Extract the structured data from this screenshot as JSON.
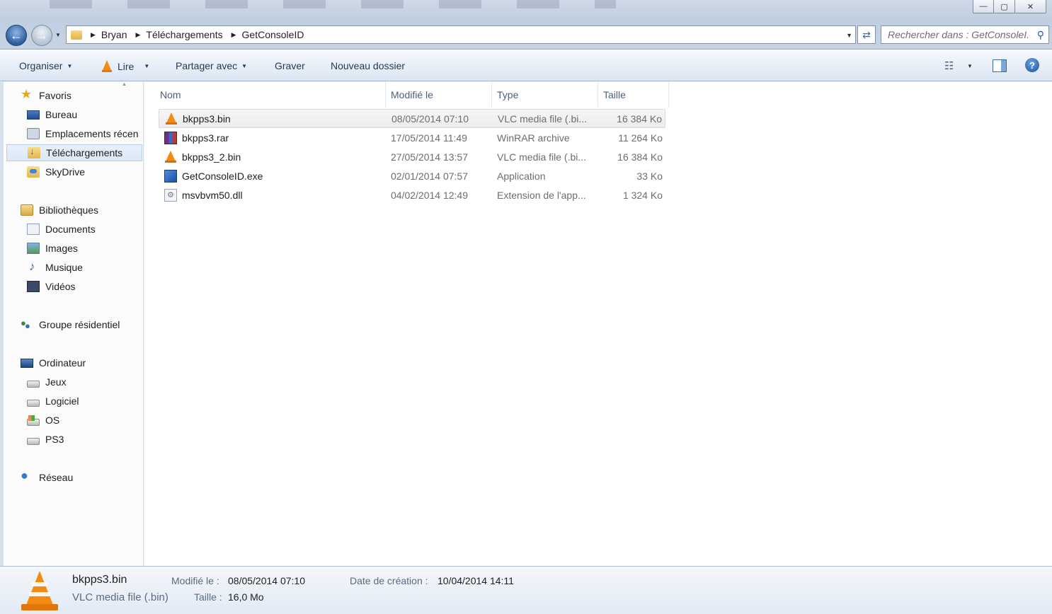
{
  "window": {
    "controls": {
      "minimize": "—",
      "maximize": "▢",
      "close": "✕"
    }
  },
  "address": {
    "crumbs": [
      "Bryan",
      "Téléchargements",
      "GetConsoleID"
    ],
    "search_placeholder": "Rechercher dans : GetConsoleI..."
  },
  "toolbar": {
    "organiser": "Organiser",
    "lire": "Lire",
    "partager": "Partager avec",
    "graver": "Graver",
    "nouveau_dossier": "Nouveau dossier"
  },
  "nav": {
    "favoris": "Favoris",
    "bureau": "Bureau",
    "emplacements": "Emplacements récen",
    "telechargements": "Téléchargements",
    "skydrive": "SkyDrive",
    "bibliotheques": "Bibliothèques",
    "documents": "Documents",
    "images": "Images",
    "musique": "Musique",
    "videos": "Vidéos",
    "groupe": "Groupe résidentiel",
    "ordinateur": "Ordinateur",
    "jeux": "Jeux",
    "logiciel": "Logiciel",
    "os": "OS",
    "ps3": "PS3",
    "reseau": "Réseau"
  },
  "columns": {
    "nom": "Nom",
    "modifie": "Modifié le",
    "type": "Type",
    "taille": "Taille"
  },
  "files": [
    {
      "name": "bkpps3.bin",
      "date": "08/05/2014 07:10",
      "type": "VLC media file (.bi...",
      "size": "16 384 Ko"
    },
    {
      "name": "bkpps3.rar",
      "date": "17/05/2014 11:49",
      "type": "WinRAR archive",
      "size": "11 264 Ko"
    },
    {
      "name": "bkpps3_2.bin",
      "date": "27/05/2014 13:57",
      "type": "VLC media file (.bi...",
      "size": "16 384 Ko"
    },
    {
      "name": "GetConsoleID.exe",
      "date": "02/01/2014 07:57",
      "type": "Application",
      "size": "33 Ko"
    },
    {
      "name": "msvbvm50.dll",
      "date": "04/02/2014 12:49",
      "type": "Extension de l'app...",
      "size": "1 324 Ko"
    }
  ],
  "details": {
    "name": "bkpps3.bin",
    "type": "VLC media file (.bin)",
    "modified_label": "Modifié le :",
    "modified_value": "08/05/2014 07:10",
    "created_label": "Date de création :",
    "created_value": "10/04/2014 14:11",
    "size_label": "Taille :",
    "size_value": "16,0 Mo"
  }
}
